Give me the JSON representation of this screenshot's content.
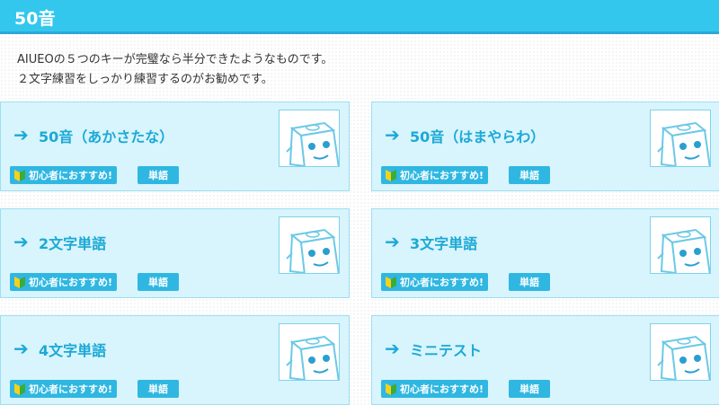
{
  "header": {
    "title": "50音"
  },
  "intro": {
    "line1": "AIUEOの５つのキーが完璧なら半分できたようなものです。",
    "line2": "２文字練習をしっかり練習するのがお勧めです。"
  },
  "cards": [
    {
      "label": "50音（あかさたな）",
      "badge": "初心者におすすめ!",
      "tag": "単語"
    },
    {
      "label": "50音（はまやらわ）",
      "badge": "初心者におすすめ!",
      "tag": "単語"
    },
    {
      "label": "2文字単語",
      "badge": "初心者におすすめ!",
      "tag": "単語"
    },
    {
      "label": "3文字単語",
      "badge": "初心者におすすめ!",
      "tag": "単語"
    },
    {
      "label": "4文字単語",
      "badge": "初心者におすすめ!",
      "tag": "単語"
    },
    {
      "label": "ミニテスト",
      "badge": "初心者におすすめ!",
      "tag": "単語"
    }
  ],
  "icons": {
    "arrow": "right-arrow-icon",
    "mascot": "box-robot-mascot-icon",
    "beginner": "beginner-leaf-icon"
  },
  "colors": {
    "header": "#33c7ee",
    "card_bg": "#d8f4fc",
    "accent": "#1ba9d6",
    "badge": "#2fb7e2"
  }
}
